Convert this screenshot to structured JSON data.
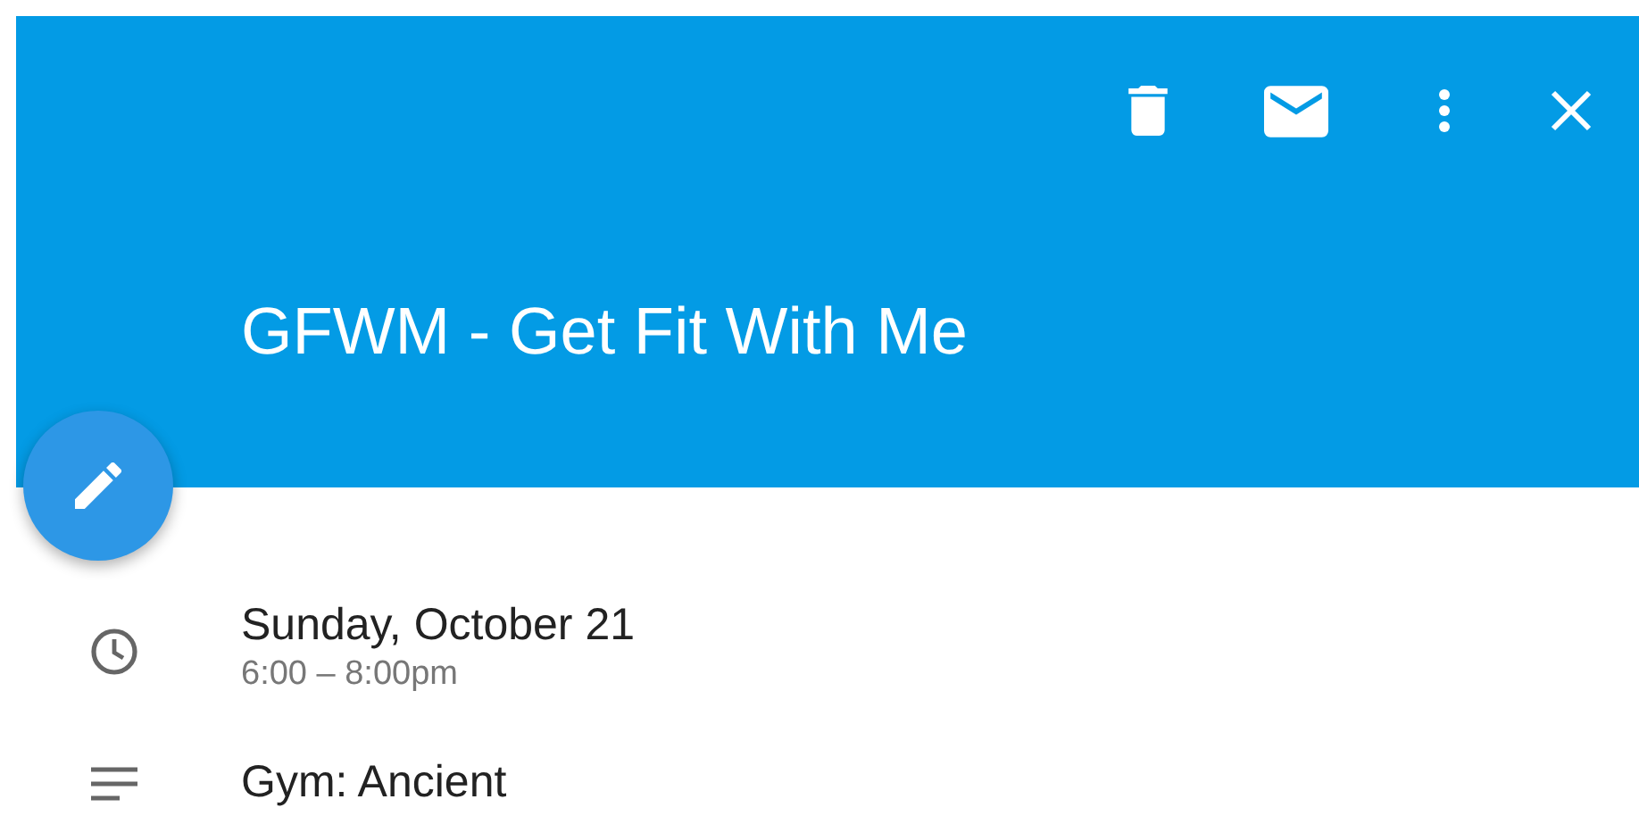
{
  "header": {
    "actions": [
      {
        "kind": "delete"
      },
      {
        "kind": "email"
      },
      {
        "kind": "more"
      },
      {
        "kind": "close"
      }
    ],
    "title": "GFWM - Get Fit With Me"
  },
  "fab": {
    "kind": "edit"
  },
  "details": [
    {
      "kind": "time",
      "primary": "Sunday, October 21",
      "secondary": "6:00 – 8:00pm"
    },
    {
      "kind": "description",
      "primary": "Gym: Ancient"
    }
  ]
}
